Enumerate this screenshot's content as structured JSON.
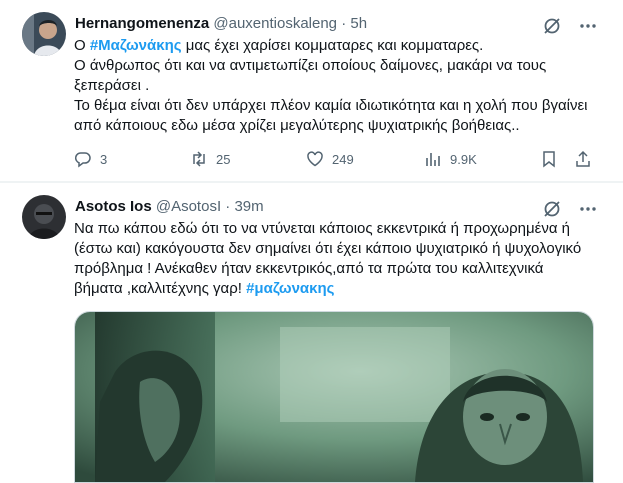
{
  "tweet1": {
    "display_name": "Hernangomenenza",
    "handle": "@auxentioskaleng",
    "separator": "·",
    "time": "5h",
    "text_parts": {
      "pre": "Ο ",
      "hashtag": "#Μαζωνάκης",
      "post": " μας έχει χαρίσει κομματαρες και κομματαρες."
    },
    "lines": [
      "Ο άνθρωπος ότι και να αντιμετωπίζει οποίους δαίμονες, μακάρι να τους ξεπεράσει .",
      "Το θέμα είναι ότι δεν υπάρχει πλέον καμία ιδιωτικότητα και η χολή που βγαίνει από κάποιους εδω μέσα χρίζει μεγαλύτερης ψυχιατρικής βοήθειας.."
    ],
    "actions": {
      "replies": "3",
      "retweets": "25",
      "likes": "249",
      "views": "9.9K"
    },
    "icons": [
      "grok-icon",
      "more-icon",
      "reply-icon",
      "retweet-icon",
      "like-icon",
      "views-icon",
      "bookmark-icon",
      "share-icon"
    ]
  },
  "tweet2": {
    "display_name": "Asotos Ios",
    "handle": "@AsotosI",
    "separator": "·",
    "time": "39m",
    "text": "Να πω κάπου εδώ ότι το να ντύνεται κάποιος εκκεντρικά ή προχωρημένα ή (έστω και) κακόγουστα δεν σημαίνει ότι έχει κάποιο ψυχιατρικό ή ψυχολογικό πρόβλημα ! Ανέκαθεν ήταν εκκεντρικός,από τα πρώτα του καλλιτεχνικά βήματα ,καλλιτέχνης γαρ! ",
    "hashtag": "#μαζωνακης",
    "media_description_colors": {
      "base": "#5f8f73",
      "dark": "#1c3027",
      "light": "#a9c7b4"
    }
  },
  "colors": {
    "accent": "#1d9bf0",
    "muted": "#536471",
    "text": "#0f1419",
    "divider": "#eff3f4"
  }
}
